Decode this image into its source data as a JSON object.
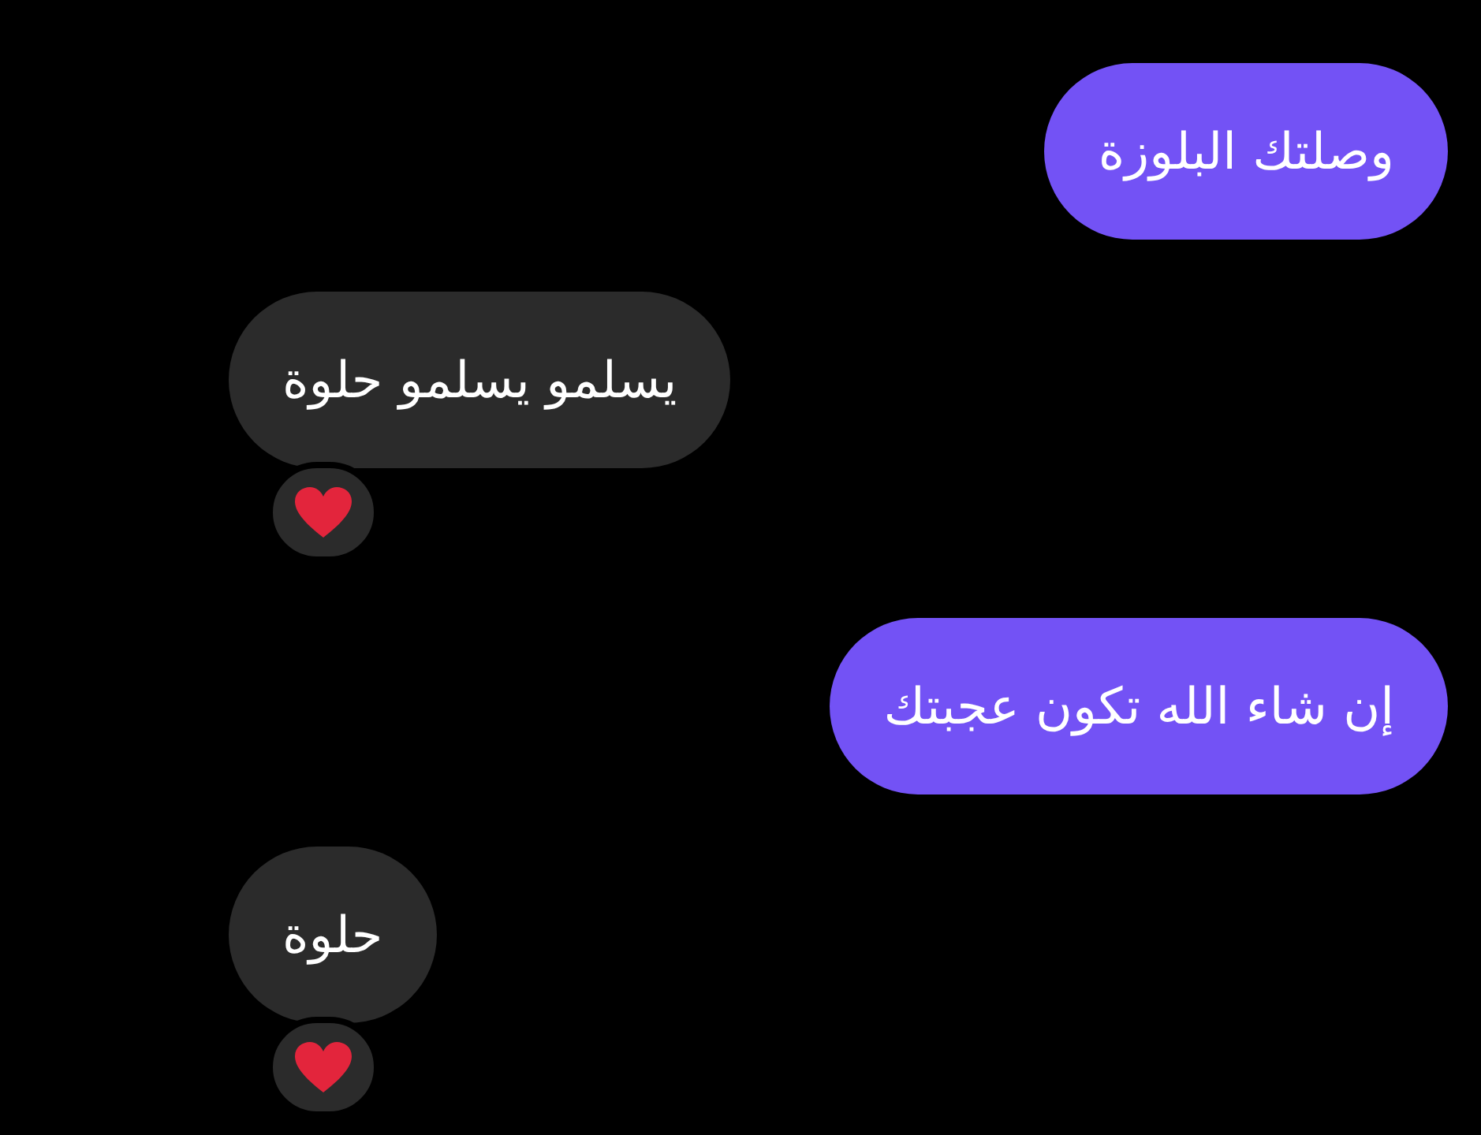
{
  "messages": [
    {
      "text": "وصلتك البلوزة",
      "kind": "sent",
      "hearted": false
    },
    {
      "text": "يسلمو يسلمو حلوة",
      "kind": "received",
      "hearted": true
    },
    {
      "text": "إن شاء الله تكون عجبتك",
      "kind": "sent",
      "hearted": false
    },
    {
      "text": "حلوة",
      "kind": "received",
      "hearted": true
    }
  ]
}
